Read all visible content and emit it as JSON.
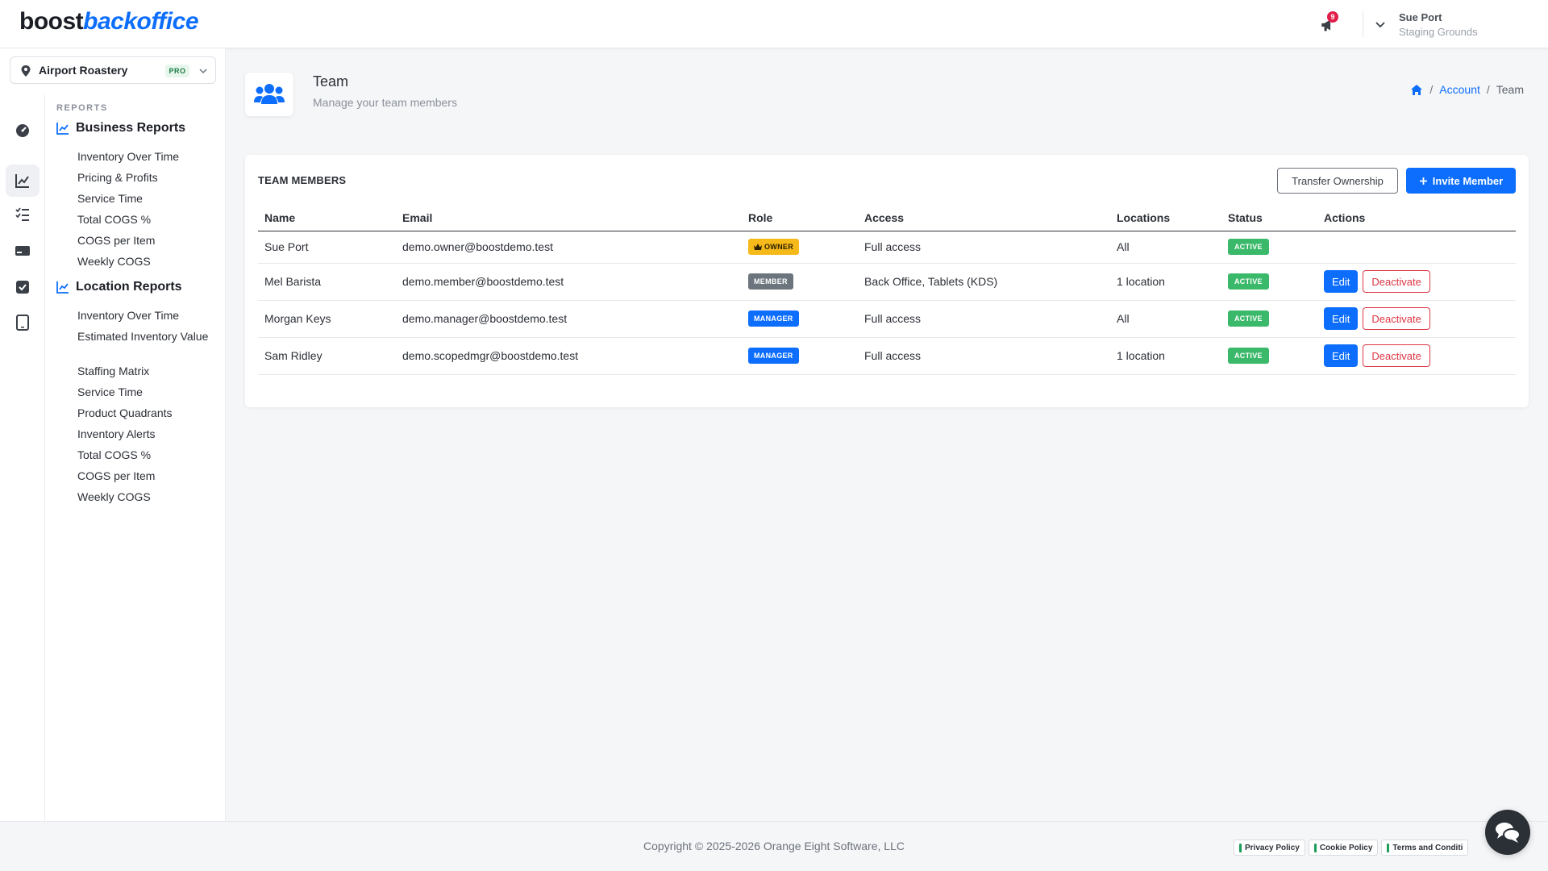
{
  "brand": {
    "part1": "boost",
    "part2": "backoffice"
  },
  "header": {
    "notification_count": "9",
    "user_name": "Sue Port",
    "user_org": "Staging Grounds"
  },
  "sidebar": {
    "location_name": "Airport Roastery",
    "plan_badge": "PRO",
    "section_heading": "REPORTS",
    "groups": [
      {
        "title": "Business Reports",
        "items": [
          "Inventory Over Time",
          "Pricing & Profits",
          "Service Time",
          "Total COGS %",
          "COGS per Item",
          "Weekly COGS"
        ]
      },
      {
        "title": "Location Reports",
        "items": [
          "Inventory Over Time",
          "Estimated Inventory Value",
          "Staffing Matrix",
          "Service Time",
          "Product Quadrants",
          "Inventory Alerts",
          "Total COGS %",
          "COGS per Item",
          "Weekly COGS"
        ]
      }
    ]
  },
  "page": {
    "title": "Team",
    "subtitle": "Manage your team members"
  },
  "breadcrumb": {
    "account": "Account",
    "current": "Team",
    "separator": "/"
  },
  "card": {
    "title": "TEAM MEMBERS",
    "transfer_label": "Transfer Ownership",
    "invite_label": "Invite Member",
    "columns": [
      "Name",
      "Email",
      "Role",
      "Access",
      "Locations",
      "Status",
      "Actions"
    ],
    "rows": [
      {
        "name": "Sue Port",
        "email": "demo.owner@boostdemo.test",
        "role": "OWNER",
        "access": "Full access",
        "locations": "All",
        "status": "ACTIVE",
        "edit": "",
        "deactivate": ""
      },
      {
        "name": "Mel Barista",
        "email": "demo.member@boostdemo.test",
        "role": "MEMBER",
        "access": "Back Office, Tablets (KDS)",
        "locations": "1 location",
        "status": "ACTIVE",
        "edit": "Edit",
        "deactivate": "Deactivate"
      },
      {
        "name": "Morgan Keys",
        "email": "demo.manager@boostdemo.test",
        "role": "MANAGER",
        "access": "Full access",
        "locations": "All",
        "status": "ACTIVE",
        "edit": "Edit",
        "deactivate": "Deactivate"
      },
      {
        "name": "Sam Ridley",
        "email": "demo.scopedmgr@boostdemo.test",
        "role": "MANAGER",
        "access": "Full access",
        "locations": "1 location",
        "status": "ACTIVE",
        "edit": "Edit",
        "deactivate": "Deactivate"
      }
    ]
  },
  "footer": {
    "copyright": "Copyright © 2025-2026 Orange Eight Software, LLC",
    "links": [
      "Privacy Policy",
      "Cookie Policy",
      "Terms and Conditi"
    ]
  },
  "colors": {
    "primary": "#0d6efd",
    "danger": "#dc3545",
    "success": "#3bb96a",
    "owner": "#f6b91a",
    "member": "#6c757d"
  },
  "icons": {
    "notification": "megaphone-icon",
    "team": "users-icon",
    "home": "home-icon",
    "chat": "chat-icon",
    "rail": [
      "dashboard-icon",
      "chart-line-icon",
      "checklist-icon",
      "card-icon",
      "checkbox-icon",
      "tablet-icon"
    ]
  }
}
